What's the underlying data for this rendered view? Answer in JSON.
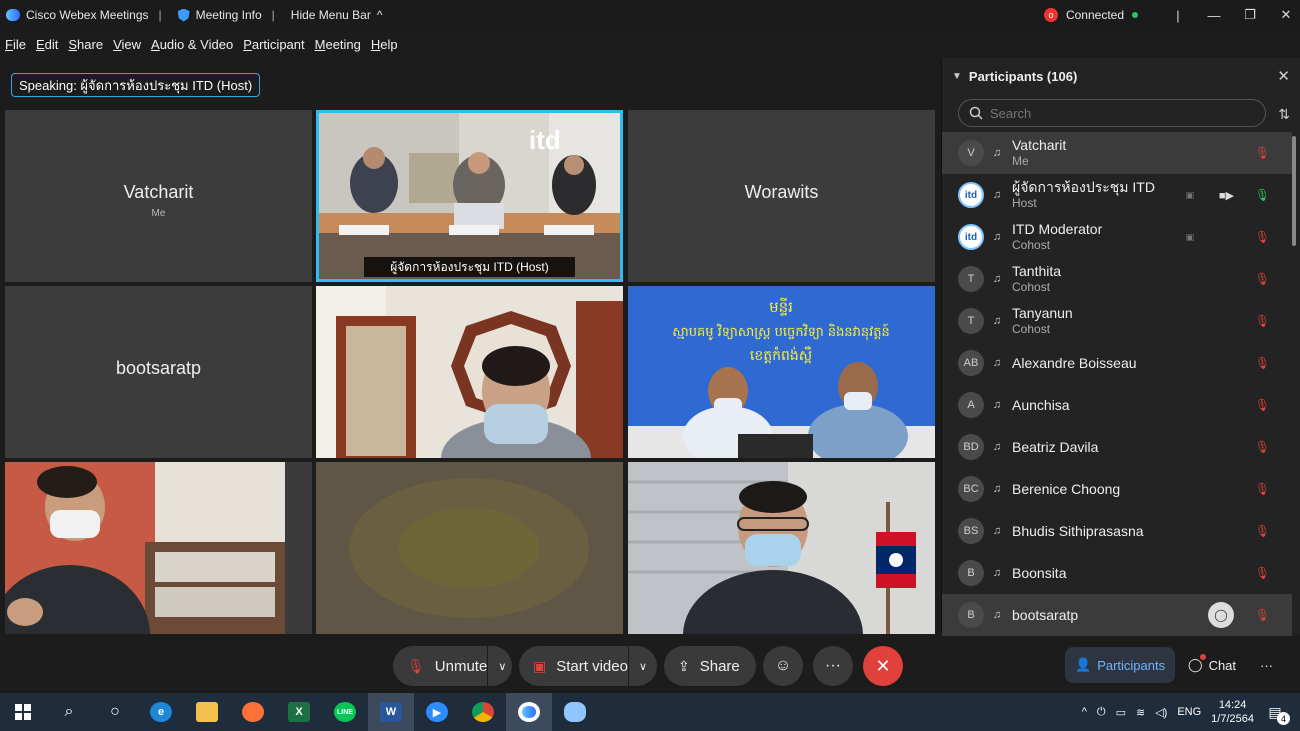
{
  "titlebar": {
    "app_name": "Cisco Webex Meetings",
    "meeting_info": "Meeting Info",
    "hide_menu_bar": "Hide Menu Bar",
    "status": "Connected"
  },
  "menu": [
    "File",
    "Edit",
    "Share",
    "View",
    "Audio & Video",
    "Participant",
    "Meeting",
    "Help"
  ],
  "speaking_label": "Speaking: ผู้จัดการห้องประชุม ITD (Host)",
  "tiles": [
    {
      "name": "Vatcharit",
      "sub": "Me"
    },
    {
      "caption": "ผู้จัดการห้องประชุม ITD  (Host)",
      "sign": "itd"
    },
    {
      "name": "Worawits"
    },
    {
      "name": "bootsaratp"
    },
    {},
    {
      "banner_line1": "មន្ទីរ",
      "banner_line2": "ស្មាបគមូ  វិទ្យាសាស្ត្រ  បច្ចេកវិទ្យា  និងនវានុវត្តន៍",
      "banner_line3": "ខេត្តកំពង់ស្ពឺ"
    },
    {},
    {},
    {}
  ],
  "participants": {
    "title": "Participants (106)",
    "search_placeholder": "Search",
    "items": [
      {
        "initials": "V",
        "name": "Vatcharit",
        "role": "Me",
        "mic": "muted",
        "selected": true
      },
      {
        "initials": "itd",
        "logo": true,
        "name": "ผู้จัดการห้องประชุม ITD",
        "role": "Host",
        "mic": "on",
        "camera": true
      },
      {
        "initials": "itd",
        "logo": true,
        "name": "ITD Moderator",
        "role": "Cohost",
        "mic": "muted"
      },
      {
        "initials": "T",
        "name": "Tanthita",
        "role": "Cohost",
        "mic": "muted"
      },
      {
        "initials": "T",
        "name": "Tanyanun",
        "role": "Cohost",
        "mic": "muted"
      },
      {
        "initials": "AB",
        "name": "Alexandre Boisseau",
        "role": "",
        "mic": "muted"
      },
      {
        "initials": "A",
        "name": "Aunchisa",
        "role": "",
        "mic": "muted"
      },
      {
        "initials": "BD",
        "name": "Beatriz Davila",
        "role": "",
        "mic": "muted"
      },
      {
        "initials": "BC",
        "name": "Berenice Choong",
        "role": "",
        "mic": "muted"
      },
      {
        "initials": "BS",
        "name": "Bhudis Sithiprasasna",
        "role": "",
        "mic": "muted"
      },
      {
        "initials": "B",
        "name": "Boonsita",
        "role": "",
        "mic": "muted"
      },
      {
        "initials": "B",
        "name": "bootsaratp",
        "role": "",
        "mic": "muted",
        "chat": true
      }
    ]
  },
  "controls": {
    "unmute": "Unmute",
    "start_video": "Start video",
    "share": "Share",
    "participants": "Participants",
    "chat": "Chat"
  },
  "taskbar": {
    "lang": "ENG",
    "time": "14:24",
    "date": "1/7/2564",
    "notifications": "4",
    "word_letter": "W",
    "excel_letter": "X",
    "line_text": "LINE"
  }
}
